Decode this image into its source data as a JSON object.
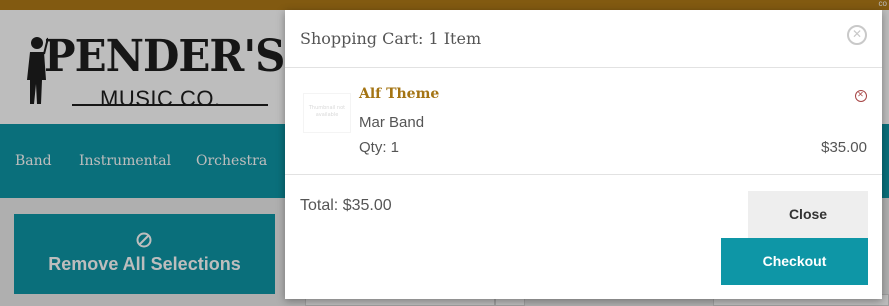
{
  "site": {
    "logo_name": "PENDER'S",
    "logo_sub": "MUSIC CO.",
    "topbar_corner": "co",
    "nav": [
      "Band",
      "Instrumental",
      "Orchestra"
    ],
    "remove_all_label": "Remove All Selections"
  },
  "cart": {
    "title": "Shopping Cart: 1 Item",
    "items": [
      {
        "title": "Alf Theme",
        "artist": "Mar Band",
        "qty": "Qty: 1",
        "price": "$35.00",
        "thumbnail_text": "Thumbnail not available"
      }
    ],
    "total": "Total: $35.00",
    "close_label": "Close",
    "checkout_label": "Checkout"
  },
  "colors": {
    "brand_teal": "#0e96a6",
    "accent_gold": "#a47413",
    "topbar": "#b07a18",
    "remove_red": "#a64545"
  },
  "icons": {
    "modal_close": "close-circle-icon",
    "item_remove": "remove-circle-icon",
    "remove_all": "ban-icon"
  }
}
